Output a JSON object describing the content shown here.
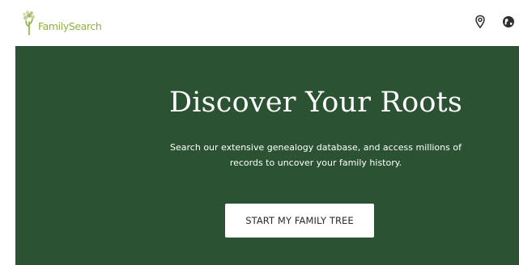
{
  "header": {
    "logo_text": "FamilySearch",
    "icons": [
      "location-pin-icon",
      "globe-icon"
    ]
  },
  "hero": {
    "title": "Discover Your Roots",
    "description": "Search our extensive genealogy database, and access millions of records to uncover your family history.",
    "cta_label": "START MY FAMILY TREE"
  },
  "colors": {
    "hero_background": "#2b5232",
    "logo_green": "#8cb13d",
    "cta_background": "#ffffff"
  }
}
